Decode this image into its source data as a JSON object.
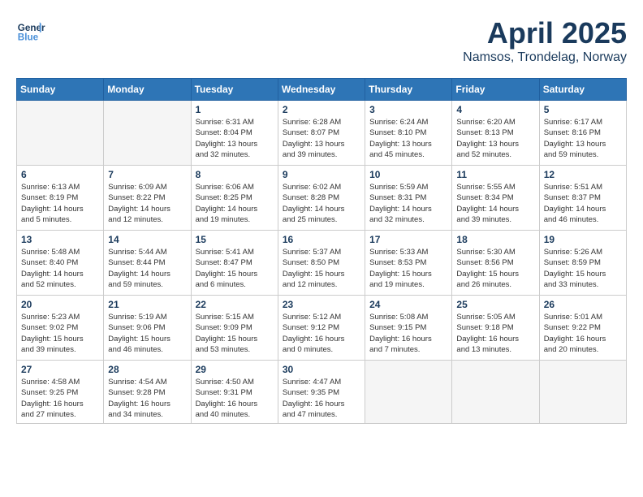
{
  "logo": {
    "line1": "General",
    "line2": "Blue"
  },
  "title": "April 2025",
  "subtitle": "Namsos, Trondelag, Norway",
  "days_header": [
    "Sunday",
    "Monday",
    "Tuesday",
    "Wednesday",
    "Thursday",
    "Friday",
    "Saturday"
  ],
  "weeks": [
    [
      {
        "day": "",
        "info": ""
      },
      {
        "day": "",
        "info": ""
      },
      {
        "day": "1",
        "info": "Sunrise: 6:31 AM\nSunset: 8:04 PM\nDaylight: 13 hours\nand 32 minutes."
      },
      {
        "day": "2",
        "info": "Sunrise: 6:28 AM\nSunset: 8:07 PM\nDaylight: 13 hours\nand 39 minutes."
      },
      {
        "day": "3",
        "info": "Sunrise: 6:24 AM\nSunset: 8:10 PM\nDaylight: 13 hours\nand 45 minutes."
      },
      {
        "day": "4",
        "info": "Sunrise: 6:20 AM\nSunset: 8:13 PM\nDaylight: 13 hours\nand 52 minutes."
      },
      {
        "day": "5",
        "info": "Sunrise: 6:17 AM\nSunset: 8:16 PM\nDaylight: 13 hours\nand 59 minutes."
      }
    ],
    [
      {
        "day": "6",
        "info": "Sunrise: 6:13 AM\nSunset: 8:19 PM\nDaylight: 14 hours\nand 5 minutes."
      },
      {
        "day": "7",
        "info": "Sunrise: 6:09 AM\nSunset: 8:22 PM\nDaylight: 14 hours\nand 12 minutes."
      },
      {
        "day": "8",
        "info": "Sunrise: 6:06 AM\nSunset: 8:25 PM\nDaylight: 14 hours\nand 19 minutes."
      },
      {
        "day": "9",
        "info": "Sunrise: 6:02 AM\nSunset: 8:28 PM\nDaylight: 14 hours\nand 25 minutes."
      },
      {
        "day": "10",
        "info": "Sunrise: 5:59 AM\nSunset: 8:31 PM\nDaylight: 14 hours\nand 32 minutes."
      },
      {
        "day": "11",
        "info": "Sunrise: 5:55 AM\nSunset: 8:34 PM\nDaylight: 14 hours\nand 39 minutes."
      },
      {
        "day": "12",
        "info": "Sunrise: 5:51 AM\nSunset: 8:37 PM\nDaylight: 14 hours\nand 46 minutes."
      }
    ],
    [
      {
        "day": "13",
        "info": "Sunrise: 5:48 AM\nSunset: 8:40 PM\nDaylight: 14 hours\nand 52 minutes."
      },
      {
        "day": "14",
        "info": "Sunrise: 5:44 AM\nSunset: 8:44 PM\nDaylight: 14 hours\nand 59 minutes."
      },
      {
        "day": "15",
        "info": "Sunrise: 5:41 AM\nSunset: 8:47 PM\nDaylight: 15 hours\nand 6 minutes."
      },
      {
        "day": "16",
        "info": "Sunrise: 5:37 AM\nSunset: 8:50 PM\nDaylight: 15 hours\nand 12 minutes."
      },
      {
        "day": "17",
        "info": "Sunrise: 5:33 AM\nSunset: 8:53 PM\nDaylight: 15 hours\nand 19 minutes."
      },
      {
        "day": "18",
        "info": "Sunrise: 5:30 AM\nSunset: 8:56 PM\nDaylight: 15 hours\nand 26 minutes."
      },
      {
        "day": "19",
        "info": "Sunrise: 5:26 AM\nSunset: 8:59 PM\nDaylight: 15 hours\nand 33 minutes."
      }
    ],
    [
      {
        "day": "20",
        "info": "Sunrise: 5:23 AM\nSunset: 9:02 PM\nDaylight: 15 hours\nand 39 minutes."
      },
      {
        "day": "21",
        "info": "Sunrise: 5:19 AM\nSunset: 9:06 PM\nDaylight: 15 hours\nand 46 minutes."
      },
      {
        "day": "22",
        "info": "Sunrise: 5:15 AM\nSunset: 9:09 PM\nDaylight: 15 hours\nand 53 minutes."
      },
      {
        "day": "23",
        "info": "Sunrise: 5:12 AM\nSunset: 9:12 PM\nDaylight: 16 hours\nand 0 minutes."
      },
      {
        "day": "24",
        "info": "Sunrise: 5:08 AM\nSunset: 9:15 PM\nDaylight: 16 hours\nand 7 minutes."
      },
      {
        "day": "25",
        "info": "Sunrise: 5:05 AM\nSunset: 9:18 PM\nDaylight: 16 hours\nand 13 minutes."
      },
      {
        "day": "26",
        "info": "Sunrise: 5:01 AM\nSunset: 9:22 PM\nDaylight: 16 hours\nand 20 minutes."
      }
    ],
    [
      {
        "day": "27",
        "info": "Sunrise: 4:58 AM\nSunset: 9:25 PM\nDaylight: 16 hours\nand 27 minutes."
      },
      {
        "day": "28",
        "info": "Sunrise: 4:54 AM\nSunset: 9:28 PM\nDaylight: 16 hours\nand 34 minutes."
      },
      {
        "day": "29",
        "info": "Sunrise: 4:50 AM\nSunset: 9:31 PM\nDaylight: 16 hours\nand 40 minutes."
      },
      {
        "day": "30",
        "info": "Sunrise: 4:47 AM\nSunset: 9:35 PM\nDaylight: 16 hours\nand 47 minutes."
      },
      {
        "day": "",
        "info": ""
      },
      {
        "day": "",
        "info": ""
      },
      {
        "day": "",
        "info": ""
      }
    ]
  ]
}
